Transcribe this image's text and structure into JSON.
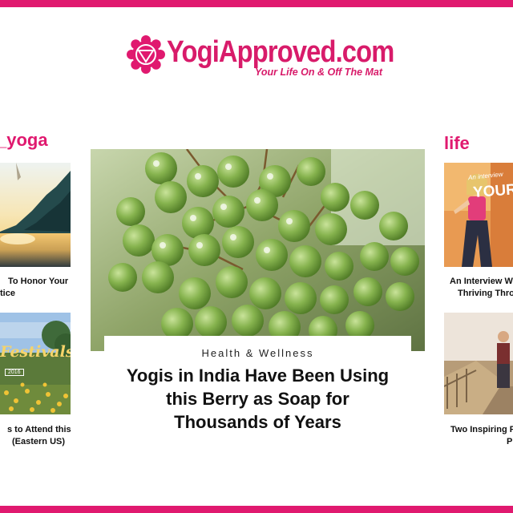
{
  "brand": {
    "name": "YogiApproved.com",
    "tagline": "Your Life On & Off The Mat",
    "icon": "lotus-chakra-icon",
    "accent_color": "#e0196f"
  },
  "left_column": {
    "category": "_yoga",
    "articles": [
      {
        "caption_line1": "To Honor Your",
        "caption_line2": "tice"
      },
      {
        "image_label_title": "Festivals",
        "image_label_year": "2016",
        "caption_line1": "s to Attend this",
        "caption_line2": "(Eastern US)"
      }
    ]
  },
  "featured": {
    "category": "Health & Wellness",
    "title_lines": [
      "Yogis in India Have Been Using",
      "this Berry as Soap for",
      "Thousands of Years"
    ]
  },
  "right_column": {
    "category": "life",
    "articles": [
      {
        "image_label_small": "An interview",
        "image_label_big": "YOUR BE",
        "caption_line1": "An Interview W",
        "caption_line2": "Thriving Thro"
      },
      {
        "caption_line1": "Two Inspiring P",
        "caption_line2": "P"
      }
    ]
  }
}
